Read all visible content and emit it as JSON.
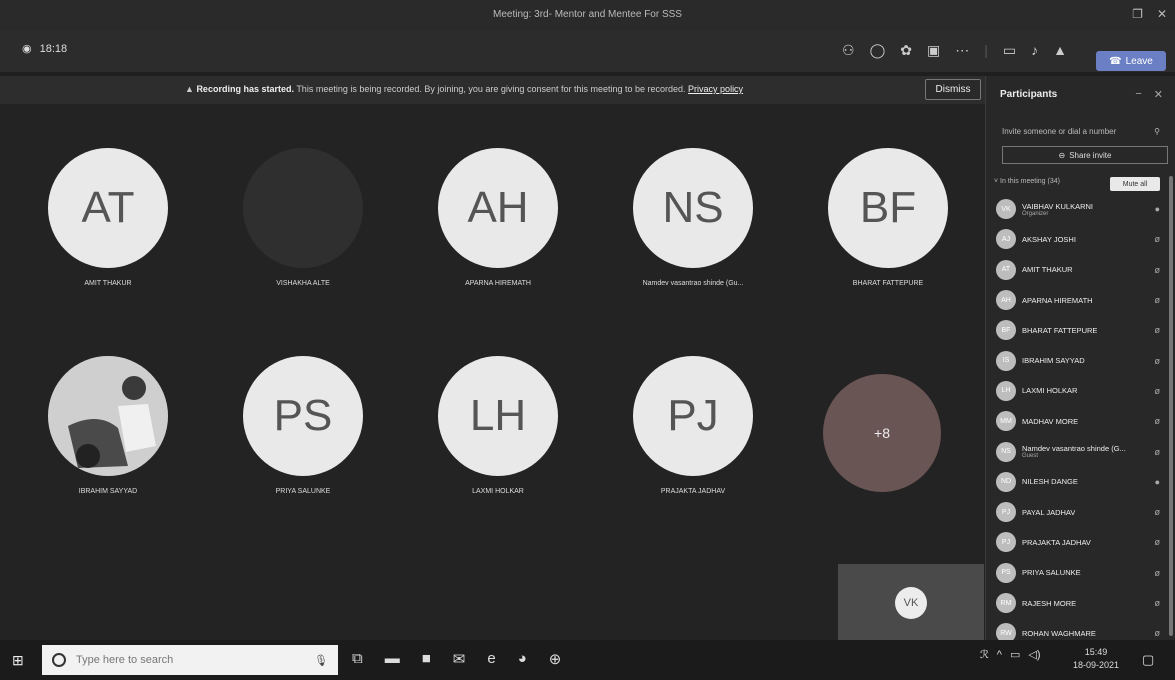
{
  "window": {
    "title": "Meeting: 3rd- Mentor and Mentee For SSS"
  },
  "toolbar": {
    "timer": "18:18",
    "leave_label": "Leave",
    "icons": [
      "participants-icon",
      "chat-icon",
      "reactions-icon",
      "rooms-icon",
      "more-icon",
      "camera-icon",
      "mic-icon",
      "share-icon"
    ]
  },
  "banner": {
    "title": "Recording has started.",
    "message": "This meeting is being recorded. By joining, you are giving consent for this meeting to be recorded.",
    "link": "Privacy policy",
    "dismiss_label": "Dismiss"
  },
  "stage": {
    "tiles": [
      {
        "initials": "AT",
        "name": "AMIT THAKUR"
      },
      {
        "initials": "",
        "name": "VISHAKHA ALTE"
      },
      {
        "initials": "AH",
        "name": "APARNA HIREMATH"
      },
      {
        "initials": "NS",
        "name": "Namdev vasantrao shinde (Gu..."
      },
      {
        "initials": "BF",
        "name": "BHARAT FATTEPURE"
      },
      {
        "initials": "",
        "name": "IBRAHIM SAYYAD"
      },
      {
        "initials": "PS",
        "name": "PRIYA SALUNKE"
      },
      {
        "initials": "LH",
        "name": "LAXMI HOLKAR"
      },
      {
        "initials": "PJ",
        "name": "PRAJAKTA JADHAV"
      }
    ],
    "overflow_label": "+8",
    "self_initials": "VK"
  },
  "participants": {
    "title": "Participants",
    "invite_placeholder": "Invite someone or dial a number",
    "share_invite_label": "Share invite",
    "section_label": "In this meeting (34)",
    "mute_all_label": "Mute all",
    "people": [
      {
        "initials": "VK",
        "name": "VAIBHAV KULKARNI",
        "sub": "Organizer"
      },
      {
        "initials": "AJ",
        "name": "AKSHAY JOSHI",
        "sub": ""
      },
      {
        "initials": "AT",
        "name": "AMIT THAKUR",
        "sub": ""
      },
      {
        "initials": "AH",
        "name": "APARNA HIREMATH",
        "sub": ""
      },
      {
        "initials": "BF",
        "name": "BHARAT FATTEPURE",
        "sub": ""
      },
      {
        "initials": "IS",
        "name": "IBRAHIM SAYYAD",
        "sub": ""
      },
      {
        "initials": "LH",
        "name": "LAXMI HOLKAR",
        "sub": ""
      },
      {
        "initials": "MM",
        "name": "MADHAV MORE",
        "sub": ""
      },
      {
        "initials": "NS",
        "name": "Namdev vasantrao shinde (G...",
        "sub": "Guest"
      },
      {
        "initials": "ND",
        "name": "NILESH DANGE",
        "sub": ""
      },
      {
        "initials": "PJ",
        "name": "PAYAL JADHAV",
        "sub": ""
      },
      {
        "initials": "PJ",
        "name": "PRAJAKTA JADHAV",
        "sub": ""
      },
      {
        "initials": "PS",
        "name": "PRIYA SALUNKE",
        "sub": ""
      },
      {
        "initials": "RM",
        "name": "RAJESH MORE",
        "sub": ""
      },
      {
        "initials": "RW",
        "name": "ROHAN WAGHMARE",
        "sub": ""
      }
    ]
  },
  "taskbar": {
    "search_placeholder": "Type here to search",
    "time": "15:49",
    "date": "18-09-2021"
  }
}
